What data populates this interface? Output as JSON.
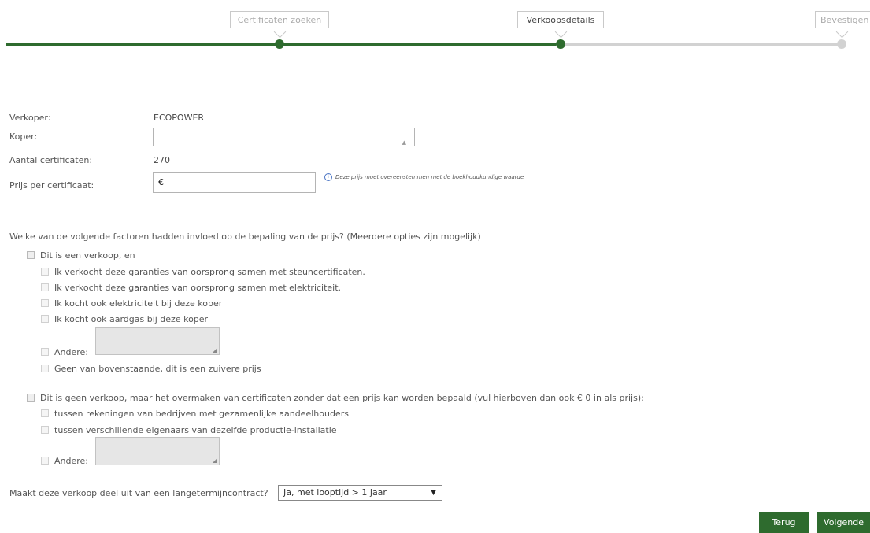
{
  "stepper": {
    "steps": [
      {
        "label": "Certificaten zoeken",
        "state": "done"
      },
      {
        "label": "Verkoopsdetails",
        "state": "current"
      },
      {
        "label": "Bevestigen",
        "state": "pending"
      }
    ],
    "colors": {
      "done": "#2e6b2e",
      "pending": "#d2d2d2"
    }
  },
  "form": {
    "seller_label": "Verkoper:",
    "seller_value": "ECOPOWER",
    "buyer_label": "Koper:",
    "buyer_value": "",
    "buyer_arrow": "▲",
    "count_label": "Aantal certificaten:",
    "count_value": "270",
    "price_label": "Prijs per certificaat:",
    "price_value": "€",
    "price_note_icon": "info-icon",
    "price_note": "Deze prijs moet overeenstemmen met de boekhoudkundige waarde"
  },
  "factors": {
    "question": "Welke van de volgende factoren hadden invloed op de bepaling van de prijs? (Meerdere opties zijn mogelijk)",
    "sale": {
      "label": "Dit is een verkoop, en",
      "options": [
        "Ik verkocht deze garanties van oorsprong samen met steuncertificaten.",
        "Ik verkocht deze garanties van oorsprong samen met elektriciteit.",
        "Ik kocht ook elektriciteit bij deze koper",
        "Ik kocht ook aardgas bij deze koper"
      ],
      "other_label": "Andere:",
      "none_label": "Geen van bovenstaande, dit is een zuivere prijs"
    },
    "transfer": {
      "label": "Dit is geen verkoop, maar het overmaken van certificaten zonder dat een prijs kan worden bepaald (vul hierboven dan ook € 0 in als prijs):",
      "options": [
        "tussen rekeningen van bedrijven met gezamenlijke aandeelhouders",
        "tussen verschillende eigenaars van dezelfde productie-installatie"
      ],
      "other_label": "Andere:"
    }
  },
  "contract": {
    "question": "Maakt deze verkoop deel uit van een langetermijncontract?",
    "selected": "Ja, met looptijd > 1 jaar",
    "arrow": "▼"
  },
  "buttons": {
    "back": "Terug",
    "next": "Volgende"
  }
}
